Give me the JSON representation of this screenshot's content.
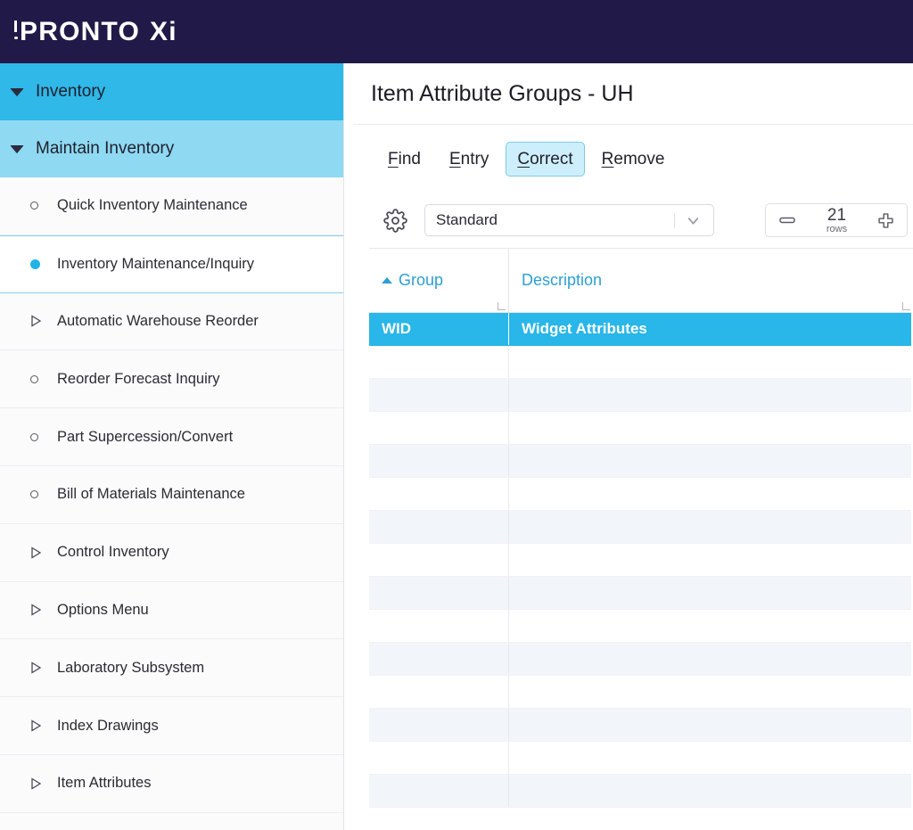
{
  "brand": {
    "logo_text_p": "P",
    "logo_text_rest": "RONTO",
    "logo_text_xi": "Xi",
    "header_color": "#211947"
  },
  "sidebar": {
    "groups": [
      {
        "label": "Inventory",
        "level": 1,
        "icon": "chevron-down-icon",
        "bg": "#2fb8e8"
      },
      {
        "label": "Maintain Inventory",
        "level": 2,
        "icon": "chevron-down-icon",
        "bg": "#8fd9f2"
      }
    ],
    "items": [
      {
        "label": "Quick Inventory Maintenance",
        "icon": "circle-outline-icon",
        "selected": false
      },
      {
        "label": "Inventory Maintenance/Inquiry",
        "icon": "circle-filled-icon",
        "selected": true
      },
      {
        "label": "Automatic Warehouse Reorder",
        "icon": "triangle-right-icon",
        "selected": false
      },
      {
        "label": "Reorder Forecast Inquiry",
        "icon": "circle-outline-icon",
        "selected": false
      },
      {
        "label": "Part Supercession/Convert",
        "icon": "circle-outline-icon",
        "selected": false
      },
      {
        "label": "Bill of Materials Maintenance",
        "icon": "circle-outline-icon",
        "selected": false
      },
      {
        "label": "Control Inventory",
        "icon": "triangle-right-icon",
        "selected": false
      },
      {
        "label": "Options Menu",
        "icon": "triangle-right-icon",
        "selected": false
      },
      {
        "label": "Laboratory Subsystem",
        "icon": "triangle-right-icon",
        "selected": false
      },
      {
        "label": "Index Drawings",
        "icon": "triangle-right-icon",
        "selected": false
      },
      {
        "label": "Item Attributes",
        "icon": "triangle-right-icon",
        "selected": false
      }
    ],
    "accent_color": "#21b3e6"
  },
  "main": {
    "page_title": "Item Attribute Groups - UH",
    "actions": [
      {
        "label": "Find",
        "accel": "F",
        "rest": "ind",
        "active": false
      },
      {
        "label": "Entry",
        "accel": "E",
        "rest": "ntry",
        "active": false
      },
      {
        "label": "Correct",
        "accel": "C",
        "rest": "orrect",
        "active": true
      },
      {
        "label": "Remove",
        "accel": "R",
        "rest": "emove",
        "active": false
      }
    ],
    "toolbar": {
      "gear_icon": "gear-icon",
      "view_select_value": "Standard",
      "view_select_placeholder": "Standard",
      "caret_icon": "chevron-down-icon",
      "minus_icon": "minus-icon",
      "plus_icon": "plus-icon",
      "rows_count": "21",
      "rows_label": "rows"
    },
    "grid": {
      "columns": [
        {
          "label": "Group",
          "sort": "asc",
          "sort_icon": "sort-ascending-icon"
        },
        {
          "label": "Description",
          "sort": "none"
        }
      ],
      "rows": [
        {
          "group": "WID",
          "description": "Widget Attributes",
          "selected": true
        },
        {
          "group": "",
          "description": "",
          "selected": false
        },
        {
          "group": "",
          "description": "",
          "selected": false
        },
        {
          "group": "",
          "description": "",
          "selected": false
        },
        {
          "group": "",
          "description": "",
          "selected": false
        },
        {
          "group": "",
          "description": "",
          "selected": false
        },
        {
          "group": "",
          "description": "",
          "selected": false
        },
        {
          "group": "",
          "description": "",
          "selected": false
        },
        {
          "group": "",
          "description": "",
          "selected": false
        },
        {
          "group": "",
          "description": "",
          "selected": false
        },
        {
          "group": "",
          "description": "",
          "selected": false
        },
        {
          "group": "",
          "description": "",
          "selected": false
        },
        {
          "group": "",
          "description": "",
          "selected": false
        },
        {
          "group": "",
          "description": "",
          "selected": false
        },
        {
          "group": "",
          "description": "",
          "selected": false
        }
      ],
      "selection_color": "#29b6e8",
      "header_text_color": "#2e9fd0",
      "alt_row_color": "#f2f5f9"
    }
  }
}
